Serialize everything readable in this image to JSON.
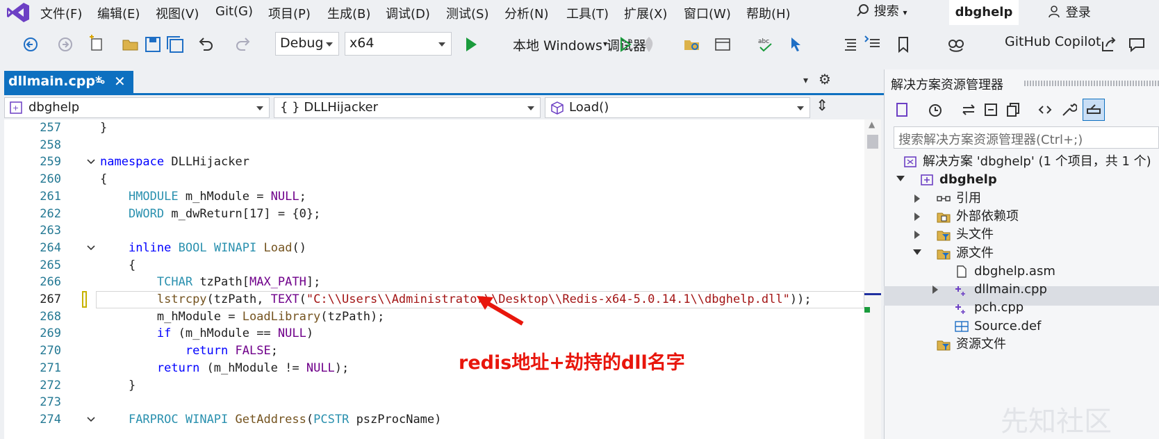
{
  "menu": {
    "items": [
      "文件(F)",
      "编辑(E)",
      "视图(V)",
      "Git(G)",
      "项目(P)",
      "生成(B)",
      "调试(D)",
      "测试(S)",
      "分析(N)",
      "工具(T)",
      "扩展(X)",
      "窗口(W)",
      "帮助(H)"
    ],
    "search_label": "搜索",
    "solution_name": "dbghelp",
    "login_label": "登录"
  },
  "toolbar": {
    "config": "Debug",
    "platform": "x64",
    "run_label": "本地 Windows 调试器",
    "copilot_label": "GitHub Copilot"
  },
  "tab": {
    "name": "dllmain.cpp*"
  },
  "navbar": {
    "project": "dbghelp",
    "scope": "{ } DLLHijacker",
    "member": "Load()"
  },
  "editor": {
    "lines": [
      {
        "n": "257",
        "text": "}"
      },
      {
        "n": "258",
        "text": ""
      },
      {
        "n": "259",
        "text": "namespace DLLHijacker"
      },
      {
        "n": "260",
        "text": "{"
      },
      {
        "n": "261",
        "text": "    HMODULE m_hModule = NULL;"
      },
      {
        "n": "262",
        "text": "    DWORD m_dwReturn[17] = {0};"
      },
      {
        "n": "263",
        "text": ""
      },
      {
        "n": "264",
        "text": "    inline BOOL WINAPI Load()"
      },
      {
        "n": "265",
        "text": "    {"
      },
      {
        "n": "266",
        "text": "        TCHAR tzPath[MAX_PATH];"
      },
      {
        "n": "267",
        "text": "        lstrcpy(tzPath, TEXT(\"C:\\\\Users\\\\Administrator\\\\Desktop\\\\Redis-x64-5.0.14.1\\\\dbghelp.dll\"));"
      },
      {
        "n": "268",
        "text": "        m_hModule = LoadLibrary(tzPath);"
      },
      {
        "n": "269",
        "text": "        if (m_hModule == NULL)"
      },
      {
        "n": "270",
        "text": "            return FALSE;"
      },
      {
        "n": "271",
        "text": "        return (m_hModule != NULL);"
      },
      {
        "n": "272",
        "text": "    }"
      },
      {
        "n": "273",
        "text": ""
      },
      {
        "n": "274",
        "text": "    FARPROC WINAPI GetAddress(PCSTR pszProcName)"
      }
    ],
    "current_line": "267",
    "annotation": "redis地址+劫持的dll名字"
  },
  "solution_explorer": {
    "title": "解决方案资源管理器",
    "search_placeholder": "搜索解决方案资源管理器(Ctrl+;)",
    "tree": [
      {
        "label": "解决方案 'dbghelp' (1 个项目，共 1 个)",
        "icon": "solution-icon",
        "expander": ""
      },
      {
        "label": "dbghelp",
        "icon": "project-icon",
        "expander": "down",
        "bold": true
      },
      {
        "label": "引用",
        "icon": "references-icon",
        "expander": "right"
      },
      {
        "label": "外部依赖项",
        "icon": "external-deps-icon",
        "expander": "right"
      },
      {
        "label": "头文件",
        "icon": "folder-filter-icon",
        "expander": "right"
      },
      {
        "label": "源文件",
        "icon": "folder-filter-icon",
        "expander": "down"
      },
      {
        "label": "dbghelp.asm",
        "icon": "file-icon",
        "expander": ""
      },
      {
        "label": "dllmain.cpp",
        "icon": "cpp-file-icon",
        "expander": "right",
        "selected": true
      },
      {
        "label": "pch.cpp",
        "icon": "cpp-file-icon",
        "expander": ""
      },
      {
        "label": "Source.def",
        "icon": "def-file-icon",
        "expander": ""
      },
      {
        "label": "资源文件",
        "icon": "folder-filter-icon",
        "expander": ""
      }
    ]
  },
  "watermark": "先知社区",
  "colors": {
    "accent": "#0e70c0",
    "keyword": "#0000ff",
    "type": "#2b91af",
    "macro": "#6f008a",
    "string": "#a31515",
    "annotation": "#e8160c"
  }
}
